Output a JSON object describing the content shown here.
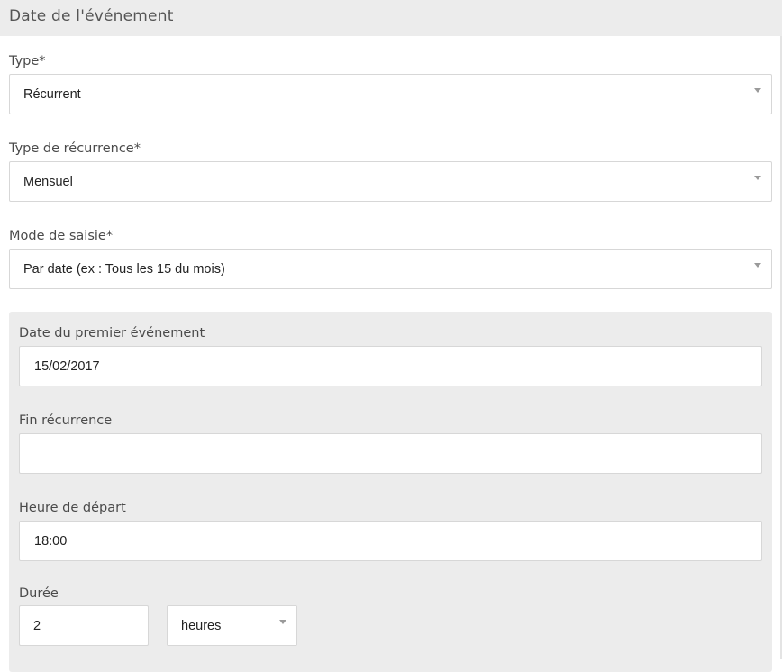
{
  "section": {
    "title": "Date de l'événement"
  },
  "fields": {
    "type": {
      "label": "Type*",
      "value": "Récurrent"
    },
    "recurrence_type": {
      "label": "Type de récurrence*",
      "value": "Mensuel"
    },
    "input_mode": {
      "label": "Mode de saisie*",
      "value": "Par date (ex : Tous les 15 du mois)"
    }
  },
  "panel": {
    "first_event_date": {
      "label": "Date du premier événement",
      "value": "15/02/2017"
    },
    "recurrence_end": {
      "label": "Fin récurrence",
      "value": ""
    },
    "start_time": {
      "label": "Heure de départ",
      "value": "18:00"
    },
    "duration": {
      "label": "Durée",
      "value": "2",
      "unit": "heures"
    }
  },
  "icons": {
    "dropdown": "chevron-down-icon"
  }
}
